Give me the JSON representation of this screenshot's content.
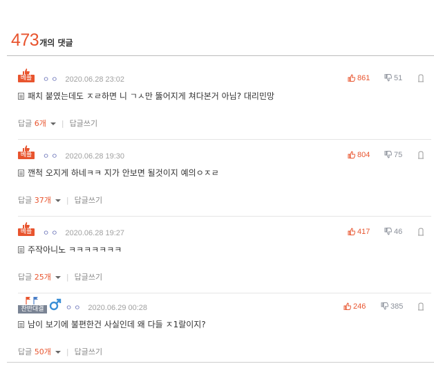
{
  "header": {
    "count": "473",
    "label": "개의 댓글"
  },
  "comments": [
    {
      "badge": "베플",
      "badge_type": "best",
      "nick": "ㅇㅇ",
      "date": "2020.06.28 23:02",
      "likes": "861",
      "dislikes": "51",
      "text": "패치 붙였는데도 ㅈㄹ하면 니 ㄱㅅ만 뚫어지게 쳐다본거 아님? 대리민망",
      "reply_prefix": "답글",
      "reply_count": "6개",
      "write_reply": "답글쓰기"
    },
    {
      "badge": "베플",
      "badge_type": "best",
      "nick": "ㅇㅇ",
      "date": "2020.06.28 19:30",
      "likes": "804",
      "dislikes": "75",
      "text": "깬척 오지게 하네ㅋㅋ 지가 안보면 될것이지 예의ㅇㅈㄹ",
      "reply_prefix": "답글",
      "reply_count": "37개",
      "write_reply": "답글쓰기"
    },
    {
      "badge": "베플",
      "badge_type": "best",
      "nick": "ㅇㅇ",
      "date": "2020.06.28 19:27",
      "likes": "417",
      "dislikes": "46",
      "text": "주작아니노 ㅋㅋㅋㅋㅋㅋㅋ",
      "reply_prefix": "답글",
      "reply_count": "25개",
      "write_reply": "답글쓰기"
    },
    {
      "badge": "찬반대결",
      "badge_type": "debate",
      "nick": "ㅇㅇ",
      "date": "2020.06.29 00:28",
      "likes": "246",
      "dislikes": "385",
      "text": "남이 보기에 불편한건 사실인데 왜 다들 ㅈ1랄이지?",
      "reply_prefix": "답글",
      "reply_count": "50개",
      "write_reply": "답글쓰기"
    }
  ],
  "colors": {
    "accent": "#e8542e",
    "debate_badge": "#7a8494",
    "nick": "#6a73b8"
  },
  "icons": {
    "like": "thumbs-up-icon",
    "dislike": "thumbs-down-icon",
    "report": "report-icon",
    "doc": "document-icon",
    "gender": "male-icon"
  }
}
